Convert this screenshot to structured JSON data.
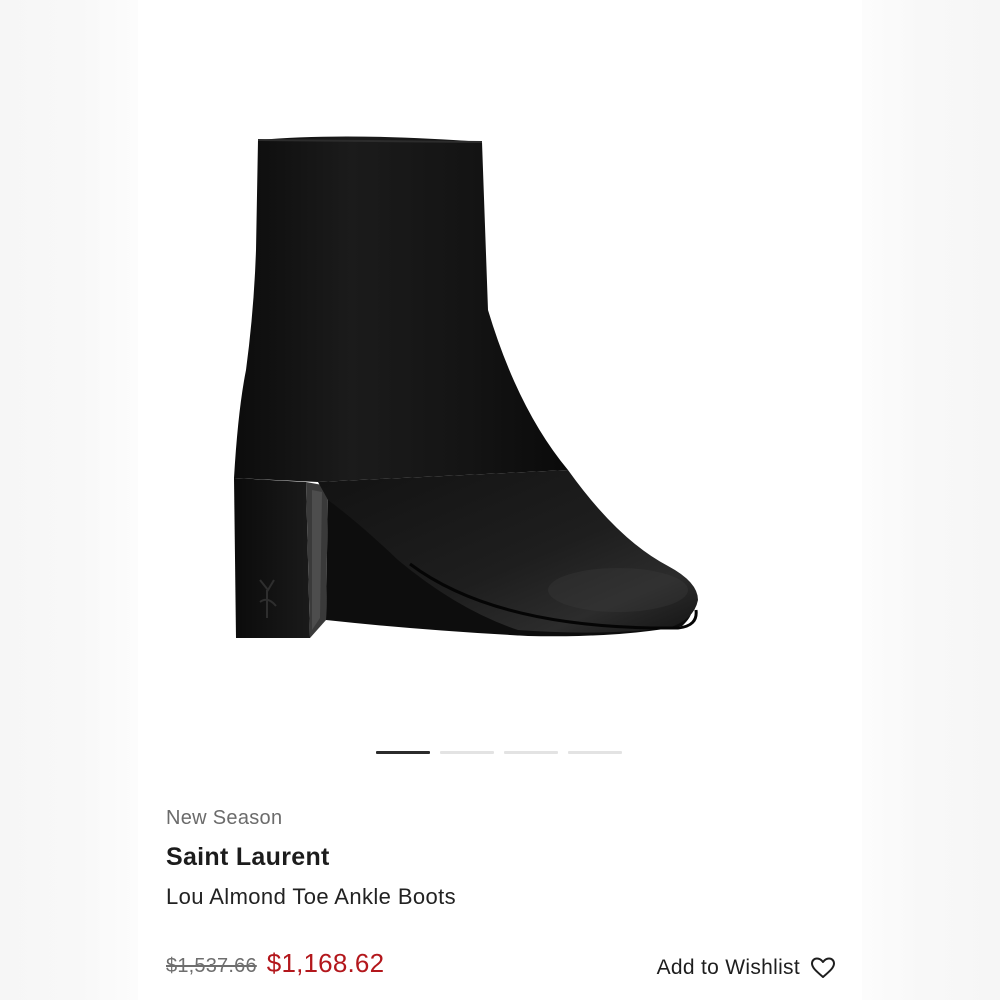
{
  "product": {
    "season_label": "New Season",
    "brand": "Saint Laurent",
    "name": "Lou Almond Toe Ankle Boots",
    "original_price": "$1,537.66",
    "sale_price": "$1,168.62",
    "sale_price_color": "#b3171c"
  },
  "carousel": {
    "total_images": 4,
    "active_index": 0
  },
  "wishlist": {
    "label": "Add to Wishlist",
    "icon": "heart-outline-icon"
  }
}
